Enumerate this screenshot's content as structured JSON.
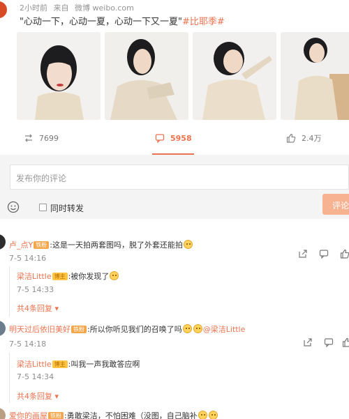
{
  "post": {
    "time": "2小时前",
    "source_prefix": "来自",
    "source": "微博 weibo.com",
    "text": "\"心动一下，心动一夏，心动一下又一夏\"",
    "tag": "#比耶季#"
  },
  "actions": {
    "repost_count": "7699",
    "comment_count": "5958",
    "like_count": "2.4万"
  },
  "composer": {
    "placeholder": "发布你的评论",
    "repost_label": "同时转发",
    "submit_label": "评论"
  },
  "comments": [
    {
      "user": "卢_点Y",
      "badge": "铁粉",
      "text": ":这是一天拍两套图吗，脱了外套还能拍",
      "time": "7-5 14:16",
      "reply": {
        "user": "梁洁Little",
        "badge": "博主",
        "text": ":被你发现了",
        "time": "7-5 14:33"
      },
      "more": "共4条回复"
    },
    {
      "user": "明天过后依旧美好",
      "badge": "铁粉",
      "text": ":所以你听见我们的召唤了吗",
      "mention": "@梁洁Little",
      "time": "7-5 14:18",
      "reply": {
        "user": "梁洁Little",
        "badge": "博主",
        "text": ":叫我一声我敢答应啊",
        "time": "7-5 14:34"
      },
      "more": "共4条回复"
    },
    {
      "user": "爱你的画屋",
      "badge": "铁粉",
      "text": ":勇敢梁洁，不怕困难（没图，自己脑补"
    }
  ],
  "colors": {
    "accent": "#eb7350",
    "muted": "#939393",
    "panel": "#f4f4f4"
  }
}
